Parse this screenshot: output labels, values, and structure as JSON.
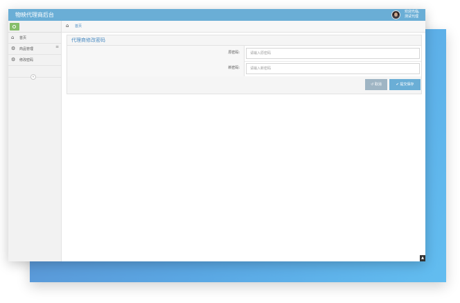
{
  "app": {
    "title": "物映代理商后台"
  },
  "user": {
    "line1": "欢迎光临,",
    "line2": "测试代理"
  },
  "sidebar": {
    "items": [
      {
        "label": "首页",
        "icon": "home-icon"
      },
      {
        "label": "商品管理",
        "icon": "cogs-icon"
      },
      {
        "label": "修改密码",
        "icon": "cogs-icon"
      }
    ],
    "collapse_glyph": "«"
  },
  "breadcrumb": {
    "home": "首页"
  },
  "form": {
    "title": "代理商修改密码",
    "old_password": {
      "label": "原密码:",
      "placeholder": "请输入原密码"
    },
    "new_password": {
      "label": "新密码:",
      "placeholder": "请输入新密码"
    },
    "cancel_label": "取消",
    "submit_label": "提交保存"
  },
  "colors": {
    "header": "#6aaed6",
    "accent_green": "#86be6a",
    "link": "#4a8bc2"
  }
}
